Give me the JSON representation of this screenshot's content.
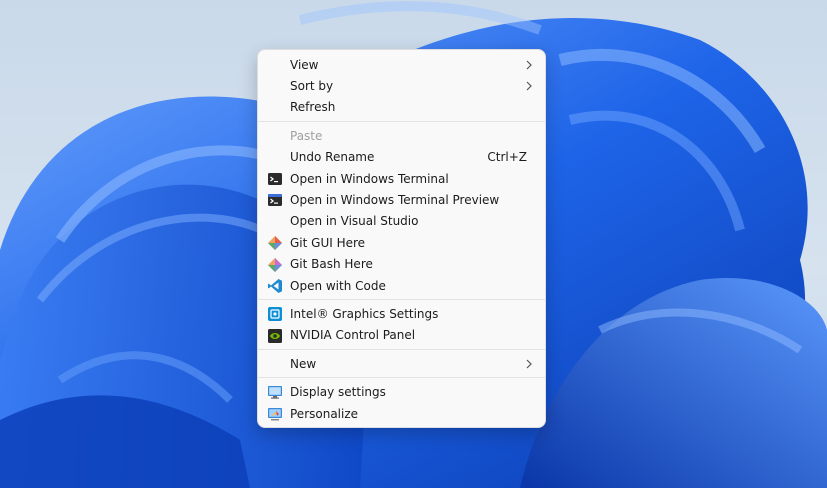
{
  "menu": {
    "group1": [
      {
        "label": "View",
        "submenu": true
      },
      {
        "label": "Sort by",
        "submenu": true
      },
      {
        "label": "Refresh"
      }
    ],
    "group2": [
      {
        "label": "Paste",
        "disabled": true
      },
      {
        "label": "Undo Rename",
        "shortcut": "Ctrl+Z"
      },
      {
        "label": "Open in Windows Terminal",
        "icon": "terminal-icon"
      },
      {
        "label": "Open in Windows Terminal Preview",
        "icon": "terminal-preview-icon"
      },
      {
        "label": "Open in Visual Studio"
      },
      {
        "label": "Git GUI Here",
        "icon": "git-gui-icon"
      },
      {
        "label": "Git Bash Here",
        "icon": "git-bash-icon"
      },
      {
        "label": "Open with Code",
        "icon": "vscode-icon"
      }
    ],
    "group3": [
      {
        "label": "Intel® Graphics Settings",
        "icon": "intel-graphics-icon"
      },
      {
        "label": "NVIDIA Control Panel",
        "icon": "nvidia-icon"
      }
    ],
    "group4": [
      {
        "label": "New",
        "submenu": true
      }
    ],
    "group5": [
      {
        "label": "Display settings",
        "icon": "display-settings-icon"
      },
      {
        "label": "Personalize",
        "icon": "personalize-icon"
      }
    ]
  },
  "colors": {
    "wallpaper_blue": "#1a5fe0",
    "wallpaper_light": "#4f8ff7",
    "wallpaper_dark": "#0b3cb0",
    "menu_bg": "#f9f9f9"
  }
}
